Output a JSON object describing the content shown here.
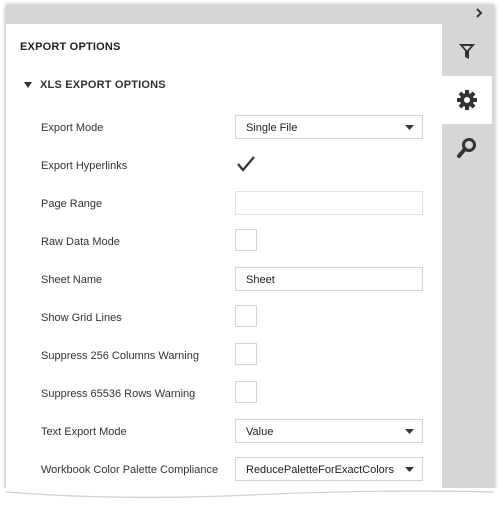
{
  "panel": {
    "title": "EXPORT OPTIONS",
    "section_title": "XLS EXPORT OPTIONS"
  },
  "tabs": [
    {
      "icon": "filter-icon",
      "active": false
    },
    {
      "icon": "gear-icon",
      "active": true
    },
    {
      "icon": "search-icon",
      "active": false
    }
  ],
  "options": {
    "export_mode": {
      "label": "Export Mode",
      "value": "Single File"
    },
    "export_hyperlinks": {
      "label": "Export Hyperlinks",
      "checked": true
    },
    "page_range": {
      "label": "Page Range",
      "value": ""
    },
    "raw_data_mode": {
      "label": "Raw Data Mode",
      "checked": false
    },
    "sheet_name": {
      "label": "Sheet Name",
      "value": "Sheet"
    },
    "show_grid_lines": {
      "label": "Show Grid Lines",
      "checked": false
    },
    "suppress_256": {
      "label": "Suppress 256 Columns Warning",
      "checked": false
    },
    "suppress_65536": {
      "label": "Suppress 65536 Rows Warning",
      "checked": false
    },
    "text_export_mode": {
      "label": "Text Export Mode",
      "value": "Value"
    },
    "color_palette": {
      "label": "Workbook Color Palette Compliance",
      "value": "ReducePaletteForExactColors"
    }
  },
  "colors": {
    "sidebar_bg": "#d6d6d6",
    "icon": "#333333",
    "border": "#d4d4d4"
  }
}
